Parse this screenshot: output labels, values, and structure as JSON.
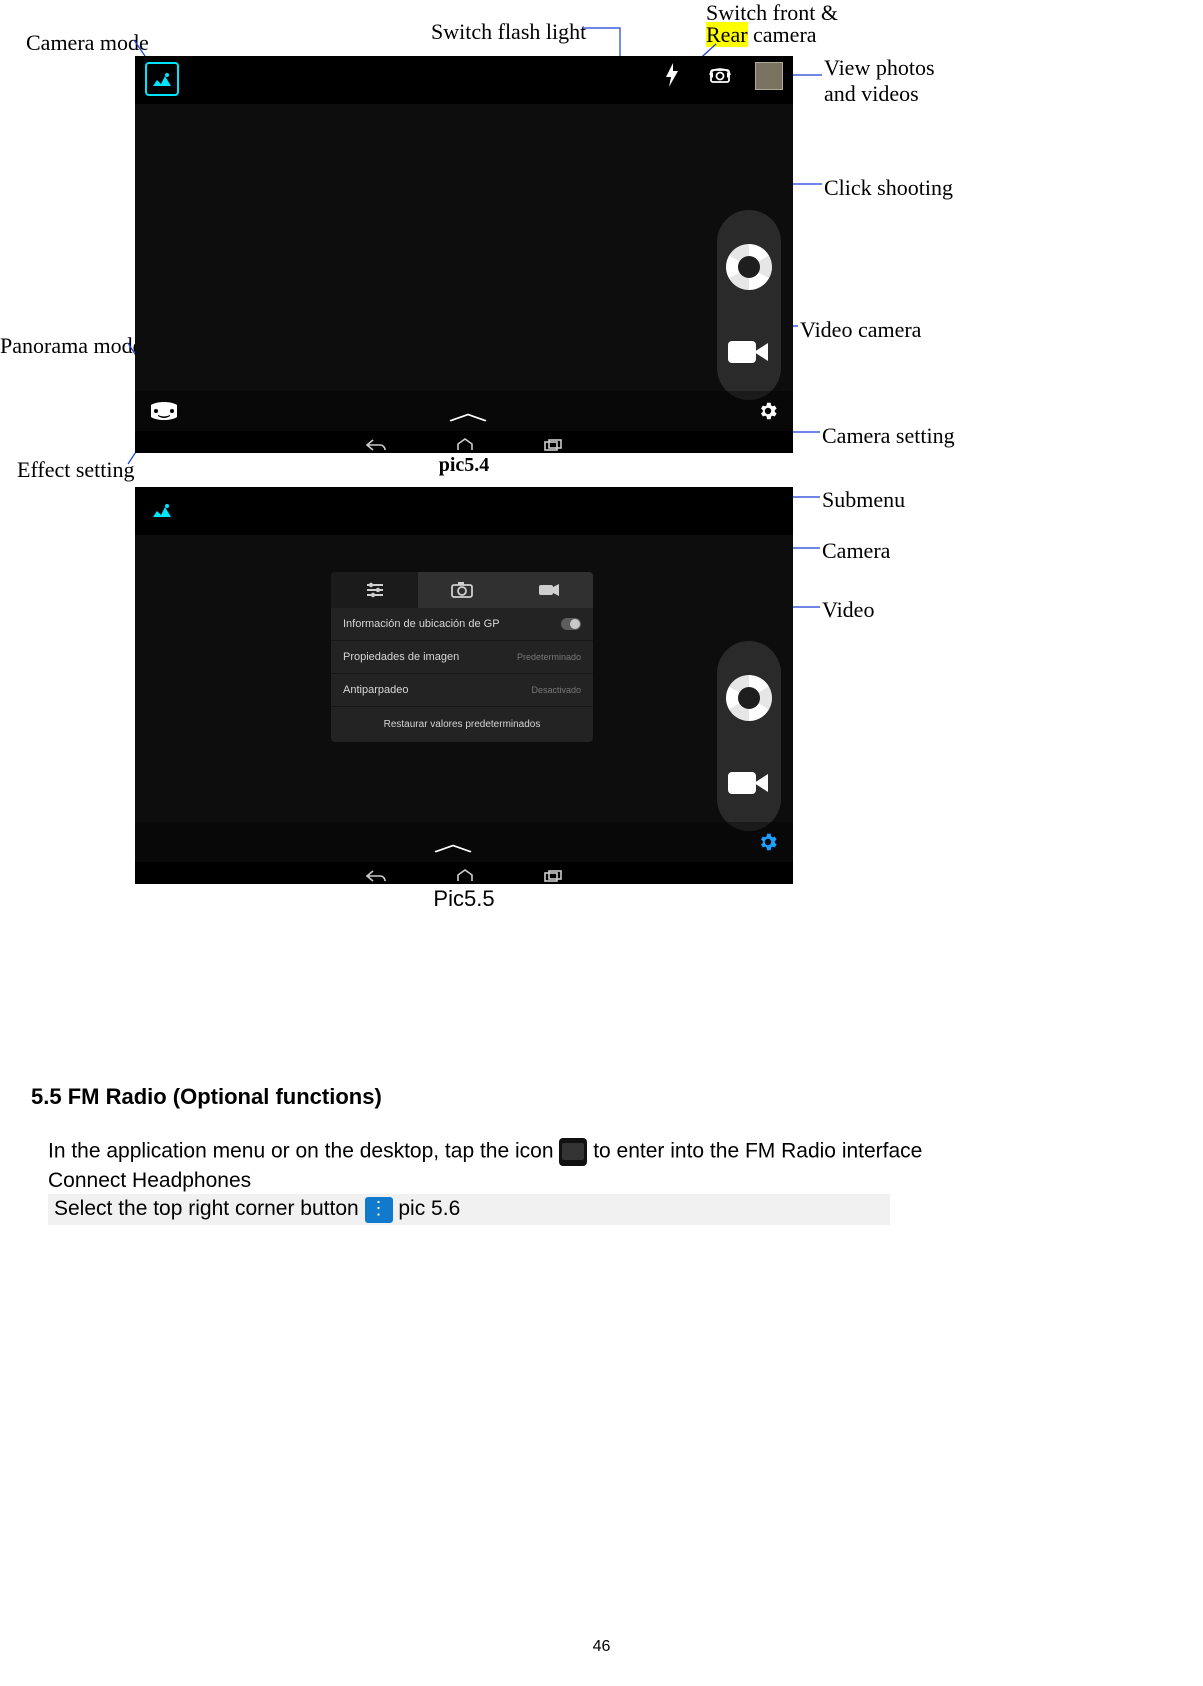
{
  "callouts": {
    "camera_mode": "Camera mode",
    "switch_flash": "Switch flash light",
    "switch_front_rear_line1": "Switch front &",
    "switch_front_rear_line2_hl": "Rear",
    "switch_front_rear_line2_rest": " camera",
    "view_photos": "View photos\nand videos",
    "click_shooting": "Click shooting",
    "video_camera": "Video camera",
    "camera_setting": "Camera setting",
    "effect_setting": "Effect setting",
    "panorama_mode": "Panorama mode",
    "submenu": "Submenu",
    "camera": "Camera",
    "video": "Video"
  },
  "captions": {
    "pic54": "pic5.4",
    "pic55": "Pic5.5"
  },
  "settings_panel": {
    "row1_label": "Información de ubicación de GP",
    "row2_label": "Propiedades de imagen",
    "row2_value": "Predeterminado",
    "row3_label": "Antiparpadeo",
    "row3_value": "Desactivado",
    "row4_label": "Restaurar valores predeterminados"
  },
  "section": {
    "title": "5.5 FM Radio (Optional functions)",
    "line1_a": "In the application menu or on the desktop, tap the icon ",
    "line1_b": " to enter into the FM Radio interface",
    "line2": "Connect Headphones",
    "line3_a": "  Select the top right corner button ",
    "line3_b": " pic 5.6"
  },
  "page_number": "46"
}
